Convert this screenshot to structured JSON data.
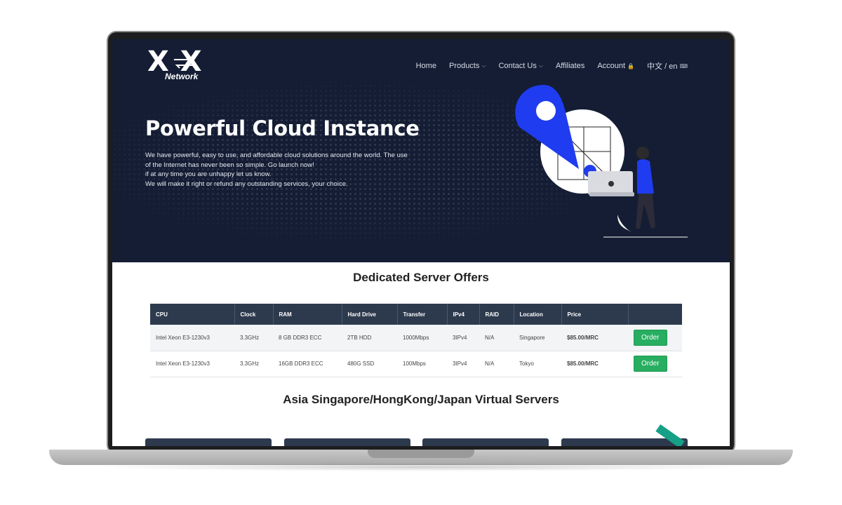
{
  "brand": {
    "logo_mark": "X  X",
    "logo_sub": "Network"
  },
  "nav": {
    "items": [
      {
        "label": "Home",
        "caret": ""
      },
      {
        "label": "Products",
        "caret": "⌵"
      },
      {
        "label": "Contact Us",
        "caret": "⌵"
      },
      {
        "label": "Affiliates",
        "caret": ""
      },
      {
        "label": "Account",
        "caret": "🔒"
      },
      {
        "label": "中文 / en",
        "caret": "⌨"
      }
    ]
  },
  "hero": {
    "title": "Powerful Cloud Instance",
    "lines": [
      "We have powerful, easy to use, and affordable cloud solutions around the world. The use of the Internet has never been so simple. Go launch now!",
      "if at any time you are unhappy let us know.",
      "We will make it right or refund any outstanding services, your choice."
    ]
  },
  "dedicated": {
    "title": "Dedicated Server Offers",
    "columns": [
      "CPU",
      "Clock",
      "RAM",
      "Hard Drive",
      "Transfer",
      "IPv4",
      "RAID",
      "Location",
      "Price",
      ""
    ],
    "rows": [
      {
        "cpu": "Intel Xeon E3-1230v3",
        "clock": "3.3GHz",
        "ram": "8 GB DDR3 ECC",
        "drive": "2TB HDD",
        "transfer": "1000Mbps",
        "ipv4": "3IPv4",
        "raid": "N/A",
        "location": "Singapore",
        "price": "$85.00/MRC",
        "action": "Order"
      },
      {
        "cpu": "Intel Xeon E3-1230v3",
        "clock": "3.3GHz",
        "ram": "16GB DDR3 ECC",
        "drive": "480G SSD",
        "transfer": "100Mbps",
        "ipv4": "3IPv4",
        "raid": "N/A",
        "location": "Tokyo",
        "price": "$85.00/MRC",
        "action": "Order"
      }
    ]
  },
  "virtual": {
    "title": "Asia Singapore/HongKong/Japan Virtual Servers"
  },
  "colors": {
    "hero_bg": "#141d33",
    "table_header": "#2d3a4e",
    "order_button": "#27ae60",
    "price": "#2a6fc4",
    "illustration_blue": "#1f3cf0"
  },
  "icons": [
    "lock-icon",
    "keyboard-icon",
    "chevron-down-icon",
    "location-pin-icon"
  ]
}
